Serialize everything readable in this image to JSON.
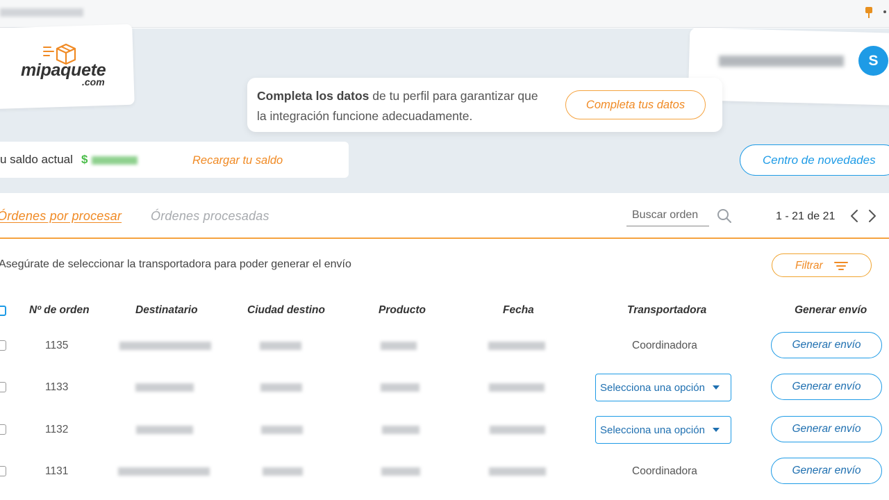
{
  "browser": {
    "url_blurred": true
  },
  "brand": {
    "name": "mipaquete",
    "domain": ".com",
    "logo_icon": "package-box-icon",
    "accent": "#f08a24"
  },
  "user": {
    "avatar_letter": "S",
    "name_blurred": true,
    "avatar_color": "#1e9be6"
  },
  "notice": {
    "bold": "Completa los datos",
    "rest1": " de tu perfil para garantizar que",
    "rest2": "la integración funcione adecuadamente.",
    "button": "Completa tus datos"
  },
  "balance": {
    "label": "u saldo actual",
    "currency": "$",
    "amount_blurred": true,
    "recharge": "Recargar tu saldo"
  },
  "news_button": "Centro de novedades",
  "tabs": [
    {
      "label": "Órdenes por procesar",
      "active": true
    },
    {
      "label": "Órdenes procesadas",
      "active": false
    }
  ],
  "search": {
    "placeholder": "Buscar orden"
  },
  "pagination": {
    "label": "1 - 21 de 21"
  },
  "hint": "Asegúrate de seleccionar la transportadora para poder generar el envío",
  "filter_button": "Filtrar",
  "table": {
    "columns": [
      "Nº de orden",
      "Destinatario",
      "Ciudad destino",
      "Producto",
      "Fecha",
      "Transportadora",
      "Generar envío"
    ],
    "rows": [
      {
        "order": "1135",
        "carrier": "Coordinadora",
        "carrier_select": false,
        "action": "Generar envío"
      },
      {
        "order": "1133",
        "carrier": "Selecciona una opción",
        "carrier_select": true,
        "action": "Generar envío"
      },
      {
        "order": "1132",
        "carrier": "Selecciona una opción",
        "carrier_select": true,
        "action": "Generar envío"
      },
      {
        "order": "1131",
        "carrier": "Coordinadora",
        "carrier_select": false,
        "action": "Generar envío"
      }
    ]
  }
}
